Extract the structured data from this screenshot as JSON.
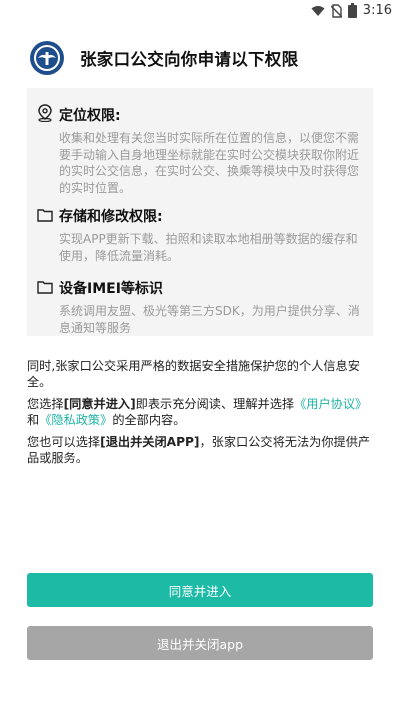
{
  "status_bar": {
    "time": "3:16"
  },
  "header": {
    "title": "张家口公交向你申请以下权限"
  },
  "permissions": [
    {
      "title": "定位权限:",
      "icon": "location-pin-icon",
      "desc": "收集和处理有关您当时实际所在位置的信息，以便您不需要手动输入自身地理坐标就能在实时公交模块获取你附近的实时公交信息，在实时公交、换乘等模块中及时获得您的实时位置。"
    },
    {
      "title": "存储和修改权限:",
      "icon": "folder-icon",
      "desc": "实现APP更新下载、拍照和读取本地相册等数据的缓存和使用，降低流量消耗。"
    },
    {
      "title": "设备IMEI等标识",
      "icon": "folder-icon",
      "desc": "系统调用友盟、极光等第三方SDK，为用户提供分享、消息通知等服务"
    }
  ],
  "notice": {
    "p1": "同时,张家口公交采用严格的数据安全措施保护您的个人信息安全。",
    "p2_a": "您选择",
    "p2_b": "[同意并进入]",
    "p2_c": "即表示充分阅读、理解并选择",
    "p2_link1": "《用户协议》",
    "p2_d": "和",
    "p2_link2": "《隐私政策》",
    "p2_e": "的全部内容。",
    "p3_a": "您也可以选择",
    "p3_b": "[退出并关闭APP]",
    "p3_c": "，张家口公交将无法为你提供产品或服务。"
  },
  "buttons": {
    "agree": "同意并进入",
    "exit": "退出并关闭app"
  },
  "colors": {
    "accent": "#1dbaa6",
    "link": "#1fb3a5",
    "exit": "#a6a6a6",
    "logo": "#1f4e8c"
  }
}
